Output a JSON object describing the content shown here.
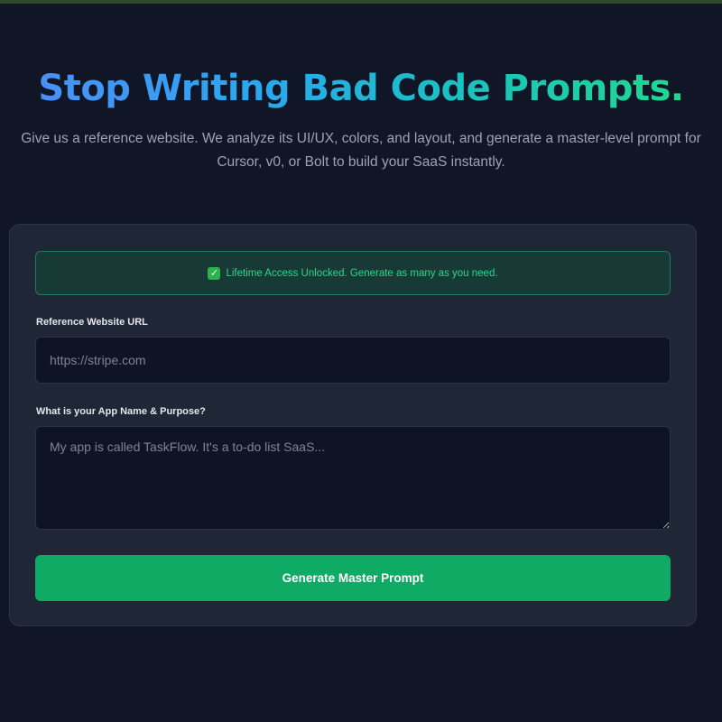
{
  "hero": {
    "title": "Stop Writing Bad Code Prompts.",
    "subtitle": "Give us a reference website. We analyze its UI/UX, colors, and layout, and generate a master-level prompt for Cursor, v0, or Bolt to build your SaaS instantly."
  },
  "form": {
    "notice": {
      "icon": "check-mark-icon",
      "text": "Lifetime Access Unlocked. Generate as many as you need."
    },
    "url_field": {
      "label": "Reference Website URL",
      "value": "",
      "placeholder": "https://stripe.com"
    },
    "purpose_field": {
      "label": "What is your App Name & Purpose?",
      "value": "",
      "placeholder": "My app is called TaskFlow. It's a to-do list SaaS..."
    },
    "submit_label": "Generate Master Prompt"
  },
  "colors": {
    "background": "#111626",
    "card": "#1f2736",
    "accent": "#0faa64",
    "notice_text": "#27d98a",
    "title_gradient": [
      "#4b8ff7",
      "#1fd98f"
    ]
  }
}
